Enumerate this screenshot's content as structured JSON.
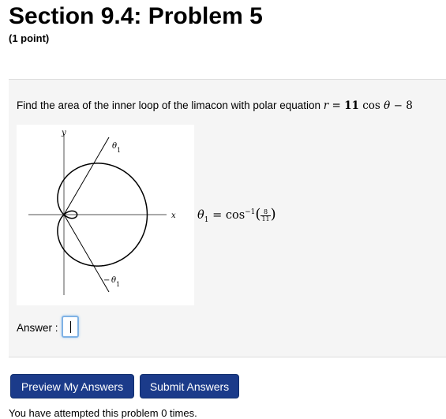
{
  "header": {
    "title": "Section 9.4: Problem 5",
    "points": "(1 point)"
  },
  "problem": {
    "question_text": "Find the area of the inner loop of the limacon with polar equation",
    "equation": {
      "r": "r",
      "eq": "=",
      "coef": "11",
      "func": "cos",
      "theta": "θ",
      "minus": "−",
      "const": "8"
    },
    "figure": {
      "y_label": "y",
      "x_label": "x",
      "theta1_upper": "θ",
      "theta1_upper_sub": "1",
      "theta1_lower_prefix": "−",
      "theta1_lower": "θ",
      "theta1_lower_sub": "1"
    },
    "theta_formula": {
      "lhs": "θ",
      "lhs_sub": "1",
      "eq": "=",
      "func": "cos",
      "sup": "−1",
      "open": "(",
      "num": "8",
      "den": "11",
      "close": ")"
    }
  },
  "answer": {
    "label": "Answer :",
    "value": ""
  },
  "buttons": {
    "preview": "Preview My Answers",
    "submit": "Submit Answers"
  },
  "status": {
    "text": "You have attempted this problem 0 times."
  }
}
